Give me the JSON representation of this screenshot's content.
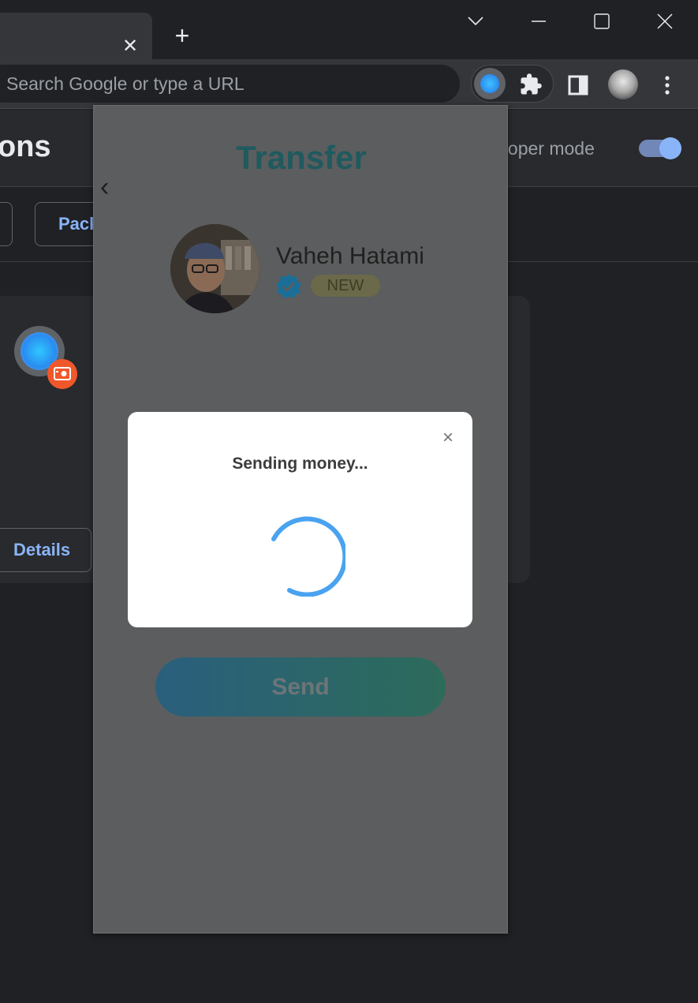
{
  "browser": {
    "omnibox": {
      "placeholder": "Search Google or type a URL"
    },
    "tab_close_glyph": "✕",
    "new_tab_glyph": "+"
  },
  "extensions_page": {
    "title": "ons",
    "developer_mode_label": "eloper mode",
    "developer_mode_on": true,
    "buttons": {
      "pack": "Pack",
      "details": "Details"
    }
  },
  "popup": {
    "title": "Transfer",
    "back_glyph": "‹",
    "contact": {
      "name": "Vaheh Hatami",
      "badge": "NEW",
      "verified": true
    },
    "send_button": "Send"
  },
  "modal": {
    "message": "Sending money...",
    "close_glyph": "×"
  },
  "colors": {
    "accent": "#8ab4f8",
    "spinner": "#4aa3f0",
    "title": "#1f5a5f",
    "verified": "#1c8fd6",
    "record_badge": "#f0582b"
  },
  "icons": [
    "tab-search-icon",
    "minimize-icon",
    "maximize-icon",
    "close-icon",
    "extensions-puzzle-icon",
    "side-panel-icon",
    "menu-dots-icon",
    "verified-icon",
    "record-icon"
  ]
}
